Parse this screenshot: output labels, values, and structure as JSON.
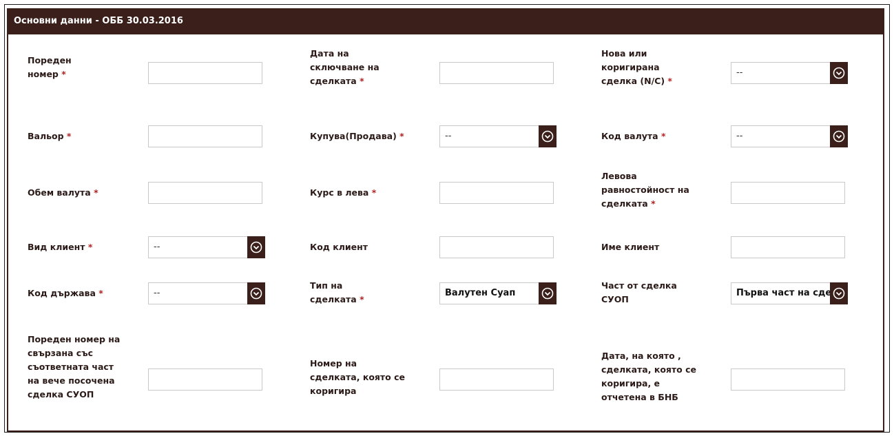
{
  "panel": {
    "title": "Основни данни - ОББ 30.03.2016"
  },
  "required_mark": "*",
  "fields": {
    "f1": {
      "label": "Пореден номер",
      "required": true,
      "value": ""
    },
    "f2": {
      "label": "Дата на сключване на сделката",
      "required": true,
      "value": ""
    },
    "f3": {
      "label": "Нова или коригирана сделка (N/C)",
      "required": true,
      "value": "--"
    },
    "f4": {
      "label": "Вальор",
      "required": true,
      "value": ""
    },
    "f5": {
      "label": "Купува(Продава)",
      "required": true,
      "value": "--"
    },
    "f6": {
      "label": "Код валута",
      "required": true,
      "value": "--"
    },
    "f7": {
      "label": "Обем валута",
      "required": true,
      "value": ""
    },
    "f8": {
      "label": "Курс в лева",
      "required": true,
      "value": ""
    },
    "f9": {
      "label": "Левова равностойност на сделката",
      "required": true,
      "value": ""
    },
    "f10": {
      "label": "Вид клиент",
      "required": true,
      "value": "--"
    },
    "f11": {
      "label": "Код клиент",
      "required": false,
      "value": ""
    },
    "f12": {
      "label": "Име клиент",
      "required": false,
      "value": ""
    },
    "f13": {
      "label": "Код държава",
      "required": true,
      "value": "--"
    },
    "f14": {
      "label": "Тип на сделката",
      "required": true,
      "value": "Валутен Суап"
    },
    "f15": {
      "label": "Част от сделка СУОП",
      "required": false,
      "value": "Първа част на сделка"
    },
    "f16": {
      "label": "Пореден номер на свързана със съответната част на вече посочена сделка СУОП",
      "required": false,
      "value": ""
    },
    "f17": {
      "label": "Номер на сделката, която се коригира",
      "required": false,
      "value": ""
    },
    "f18": {
      "label": "Дата, на която , сделката, която се коригира, е отчетена в БНБ",
      "required": false,
      "value": ""
    }
  },
  "colors": {
    "header_bg": "#3b1f1a",
    "label": "#2b1a17",
    "required": "#b22222"
  },
  "icons": {
    "dropdown": "chevron-down-circle-icon"
  }
}
